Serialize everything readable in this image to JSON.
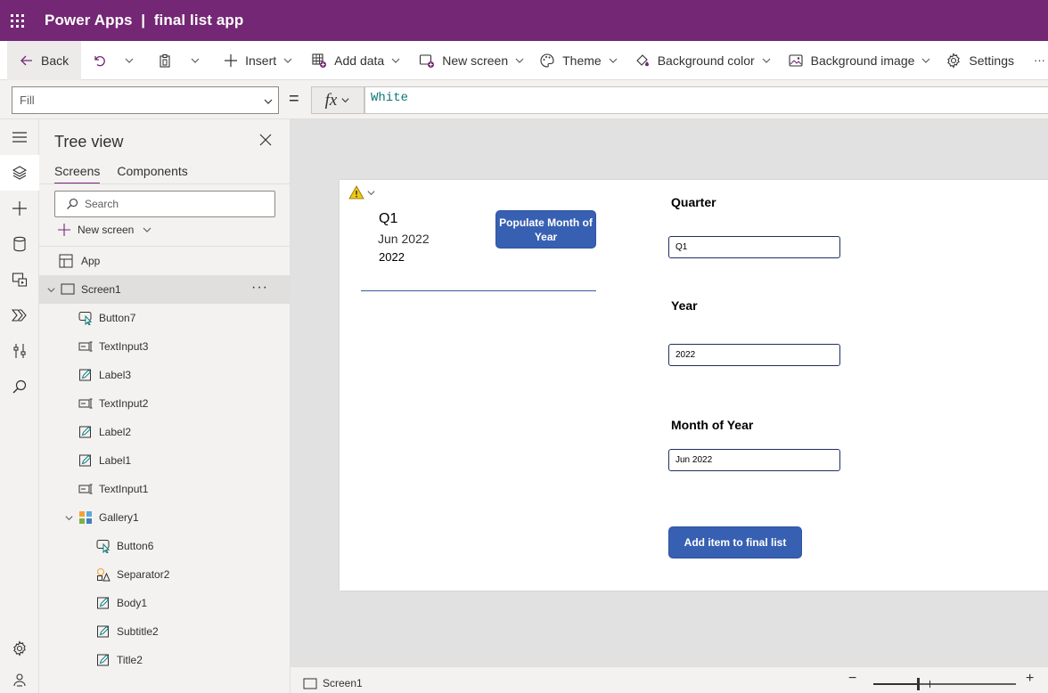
{
  "titlebar": {
    "product": "Power Apps",
    "separator": "|",
    "app_name": "final list app",
    "background": "#742774"
  },
  "commandbar": {
    "back": "Back",
    "insert": "Insert",
    "add_data": "Add data",
    "new_screen": "New screen",
    "theme": "Theme",
    "background_color": "Background color",
    "background_image": "Background image",
    "settings": "Settings",
    "more": "···"
  },
  "formulabar": {
    "property": "Fill",
    "equals": "=",
    "fx": "fx",
    "formula": "White"
  },
  "treeview": {
    "title": "Tree view",
    "tabs": [
      "Screens",
      "Components"
    ],
    "search_placeholder": "Search",
    "new_screen": "New screen",
    "nodes": [
      {
        "label": "App",
        "icon": "app-icon"
      },
      {
        "label": "Screen1",
        "icon": "screen-icon"
      },
      {
        "label": "Button7",
        "icon": "button-icon"
      },
      {
        "label": "TextInput3",
        "icon": "text-input-icon"
      },
      {
        "label": "Label3",
        "icon": "label-icon"
      },
      {
        "label": "TextInput2",
        "icon": "text-input-icon"
      },
      {
        "label": "Label2",
        "icon": "label-icon"
      },
      {
        "label": "Label1",
        "icon": "label-icon"
      },
      {
        "label": "TextInput1",
        "icon": "text-input-icon"
      },
      {
        "label": "Gallery1",
        "icon": "gallery-icon"
      },
      {
        "label": "Button6",
        "icon": "button-icon"
      },
      {
        "label": "Separator2",
        "icon": "separator-icon"
      },
      {
        "label": "Body1",
        "icon": "label-icon"
      },
      {
        "label": "Subtitle2",
        "icon": "label-icon"
      },
      {
        "label": "Title2",
        "icon": "label-icon"
      }
    ],
    "more": "···"
  },
  "canvas": {
    "gallery": {
      "title": "Q1",
      "subtitle": "Jun 2022",
      "body": "2022",
      "button": "Populate Month of Year"
    },
    "quarter_label": "Quarter",
    "quarter_value": "Q1",
    "year_label": "Year",
    "year_value": "2022",
    "month_label": "Month of Year",
    "month_value": "Jun 2022",
    "add_button": "Add item to final list",
    "button_color": "#3860b2"
  },
  "statusbar": {
    "screen": "Screen1",
    "zoom_minus": "−",
    "zoom_plus": "+"
  }
}
